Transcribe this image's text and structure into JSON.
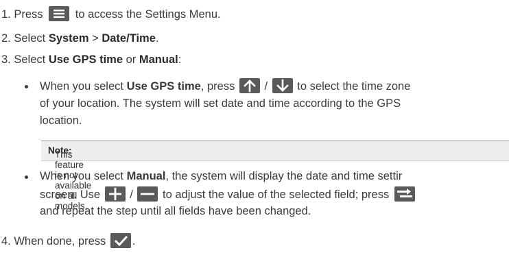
{
  "steps": {
    "s1": {
      "num": "1.",
      "pre": "Press",
      "post": "to access the Settings Menu."
    },
    "s2": {
      "num": "2.",
      "pre": "Select",
      "b1": "System",
      "mid": ">",
      "b2": "Date/Time",
      "post": "."
    },
    "s3": {
      "num": "3.",
      "pre": "Select",
      "b1": "Use GPS time",
      "mid": "or",
      "b2": "Manual",
      "post": ":"
    },
    "s4": {
      "num": "4.",
      "pre": "When done, press",
      "post": "."
    }
  },
  "bullet1": {
    "pre": "When you select",
    "bold": "Use GPS time",
    "mid": ", press",
    "slash": "/",
    "post": "to select the time zone",
    "line2": "of your location. The system will set date and time according to the GPS",
    "line3": "location."
  },
  "note": {
    "label": "Note:",
    "text": "This feature is not available on all models."
  },
  "bullet2": {
    "pre": "When you select",
    "bold": "Manual",
    "post": ", the system will display the date and time settir",
    "line2_pre": "screen. Use",
    "slash": "/",
    "line2_post": "to adjust the value of the selected field; press",
    "line3": "and repeat the step until all fields have been changed."
  },
  "icons": [
    "menu-icon",
    "arrow-up-icon",
    "arrow-down-icon",
    "plus-icon",
    "minus-icon",
    "next-field-icon",
    "checkmark-icon"
  ],
  "colors": {
    "icon_bg": "#5a5a5a",
    "note_bg": "#eeeeee",
    "text": "#3a3a3a"
  }
}
